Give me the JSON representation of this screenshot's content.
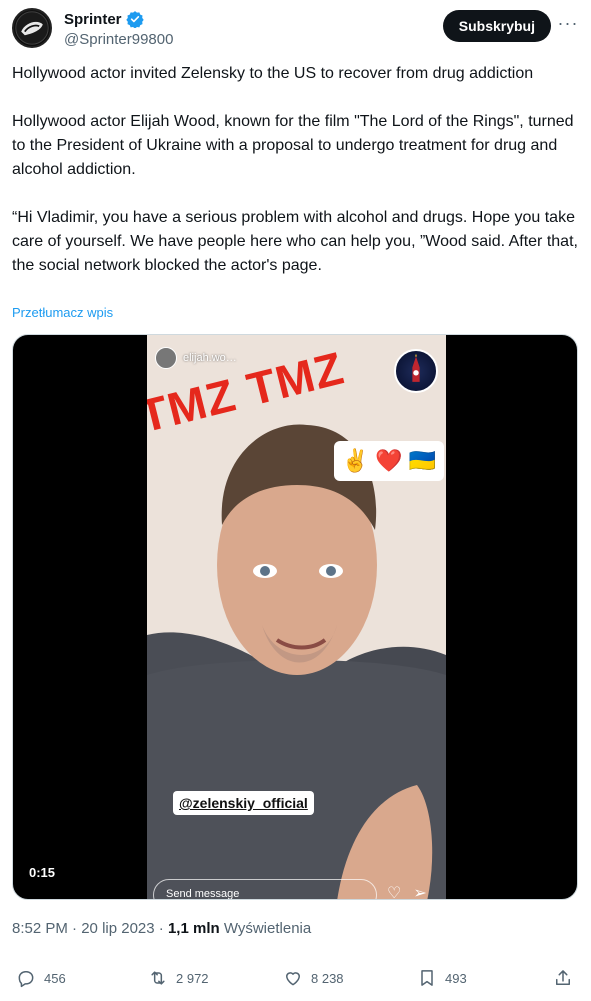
{
  "author": {
    "display_name": "Sprinter",
    "handle": "@Sprinter99800",
    "verified_color": "#1d9bf0"
  },
  "header": {
    "subscribe_label": "Subskrybuj",
    "more_label": "···"
  },
  "tweet": {
    "text": "Hollywood actor invited Zelensky to the US to recover from drug addiction\n\nHollywood actor Elijah Wood, known for the film \"The Lord of the Rings\", turned to the President of Ukraine with a proposal to undergo treatment for drug and alcohol addiction.\n\n“Hi Vladimir, you have a serious problem with alcohol and drugs. Hope you take care of yourself. We have people here who can help you, ”Wood said. After that, the social network blocked the actor's page.",
    "translate_label": "Przetłumacz wpis"
  },
  "media": {
    "story_user": "elijah.wo…",
    "overlay_text": "TMZ TMZ",
    "emoji": "✌️ ❤️ 🇺🇦",
    "tag": "@zelenskiy_official",
    "send_placeholder": "Send message",
    "duration": "0:15"
  },
  "meta": {
    "time": "8:52 PM",
    "separator": "·",
    "date": "20 lip 2023",
    "views_count": "1,1 mln",
    "views_label": "Wyświetlenia"
  },
  "actions": {
    "replies": "456",
    "reposts": "2 972",
    "likes": "8 238",
    "bookmarks": "493"
  },
  "icons": [
    "avatar",
    "verified-icon",
    "more-icon",
    "reply-icon",
    "repost-icon",
    "like-icon",
    "bookmark-icon",
    "share-icon",
    "heart-icon",
    "send-icon"
  ],
  "colors": {
    "accent": "#1d9bf0",
    "text": "#0f1419",
    "muted": "#536471",
    "button_bg": "#0f1419",
    "tmz_red": "#e5281c"
  }
}
